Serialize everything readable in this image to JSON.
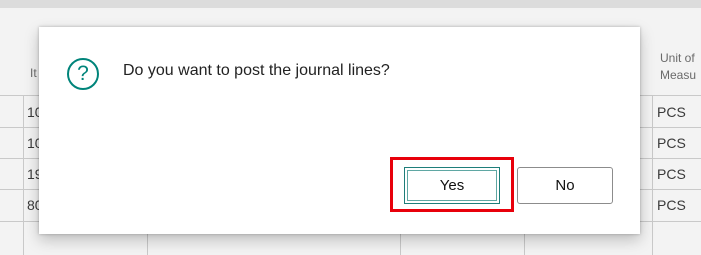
{
  "background": {
    "left_column_header": "It",
    "left_column_cells": [
      "10",
      "10",
      "19",
      "80"
    ],
    "right_column_header_line1": "Unit of",
    "right_column_header_line2": "Measu",
    "right_column_cells": [
      "PCS",
      "PCS",
      "PCS",
      "PCS"
    ]
  },
  "dialog": {
    "icon": "question-circle-icon",
    "message": "Do you want to post the journal lines?",
    "yes_label": "Yes",
    "no_label": "No",
    "icon_color": "#00847a",
    "highlight_color": "#e8000b"
  }
}
